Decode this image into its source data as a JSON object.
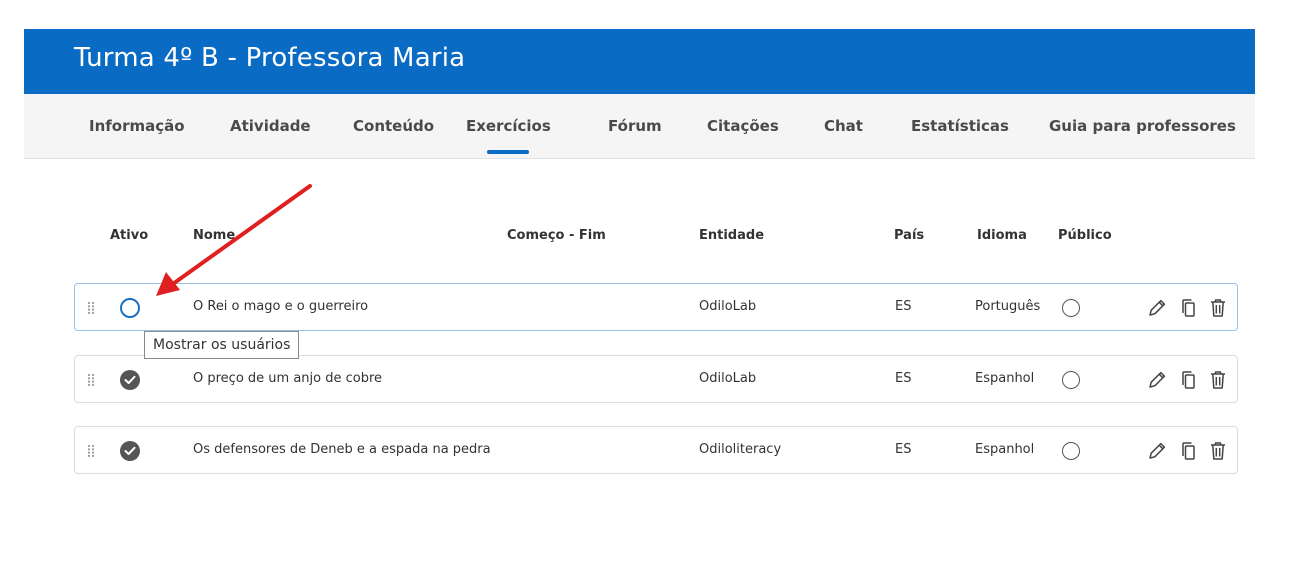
{
  "header": {
    "title": "Turma 4º B - Professora Maria"
  },
  "nav": {
    "tabs": [
      {
        "label": "Informação"
      },
      {
        "label": "Atividade"
      },
      {
        "label": "Conteúdo"
      },
      {
        "label": "Exercícios",
        "active": true
      },
      {
        "label": "Fórum"
      },
      {
        "label": "Citações"
      },
      {
        "label": "Chat"
      },
      {
        "label": "Estatísticas"
      },
      {
        "label": "Guia para professores"
      }
    ]
  },
  "table": {
    "columns": {
      "active": "Ativo",
      "name": "Nome",
      "dates": "Começo - Fim",
      "entity": "Entidade",
      "country": "País",
      "language": "Idioma",
      "public": "Público"
    },
    "rows": [
      {
        "active": false,
        "name": "O Rei o mago e o guerreiro",
        "entity": "OdiloLab",
        "country": "ES",
        "language": "Português",
        "public": false
      },
      {
        "active": true,
        "name": "O preço de um anjo de cobre",
        "entity": "OdiloLab",
        "country": "ES",
        "language": "Espanhol",
        "public": false
      },
      {
        "active": true,
        "name": "Os defensores de Deneb e a espada na pedra",
        "entity": "Odiloliteracy",
        "country": "ES",
        "language": "Espanhol",
        "public": false
      }
    ]
  },
  "tooltip": {
    "text": "Mostrar os usuários"
  },
  "icons": {
    "drag": "drag-handle-icon",
    "edit": "pencil-icon",
    "copy": "copy-icon",
    "delete": "trash-icon"
  },
  "colors": {
    "brand": "#0a6bc4",
    "annotation_arrow": "#e02020"
  }
}
